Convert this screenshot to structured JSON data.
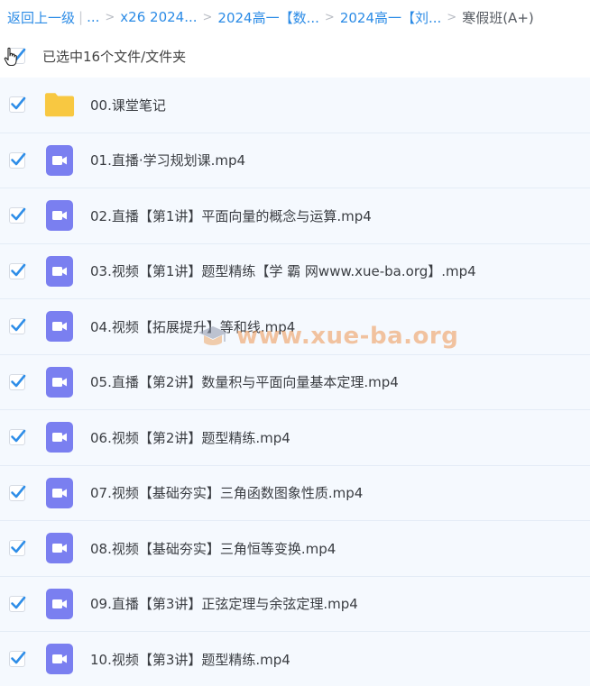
{
  "breadcrumb": {
    "back": "返回上一级",
    "bar": "|",
    "ellipsis": "...",
    "sep": ">",
    "crumbs": [
      "x26 2024...",
      "2024高一【数...",
      "2024高一【刘..."
    ],
    "current": "寒假班(A+)"
  },
  "selection": {
    "text": "已选中16个文件/文件夹"
  },
  "files": [
    {
      "name": "00.课堂笔记",
      "type": "folder"
    },
    {
      "name": "01.直播·学习规划课.mp4",
      "type": "video"
    },
    {
      "name": "02.直播【第1讲】平面向量的概念与运算.mp4",
      "type": "video"
    },
    {
      "name": "03.视频【第1讲】题型精练【学 霸 网www.xue-ba.org】.mp4",
      "type": "video"
    },
    {
      "name": "04.视频【拓展提升】等和线.mp4",
      "type": "video"
    },
    {
      "name": "05.直播【第2讲】数量积与平面向量基本定理.mp4",
      "type": "video"
    },
    {
      "name": "06.视频【第2讲】题型精练.mp4",
      "type": "video"
    },
    {
      "name": "07.视频【基础夯实】三角函数图象性质.mp4",
      "type": "video"
    },
    {
      "name": "08.视频【基础夯实】三角恒等变换.mp4",
      "type": "video"
    },
    {
      "name": "09.直播【第3讲】正弦定理与余弦定理.mp4",
      "type": "video"
    },
    {
      "name": "10.视频【第3讲】题型精练.mp4",
      "type": "video"
    }
  ],
  "watermark": {
    "text": "www.xue-ba.org"
  },
  "colors": {
    "link": "#2b8be6",
    "checkmark": "#2f8ee8",
    "folder": "#f8c841",
    "video": "#7a7ff0",
    "row_bg": "#f5f9fe"
  }
}
